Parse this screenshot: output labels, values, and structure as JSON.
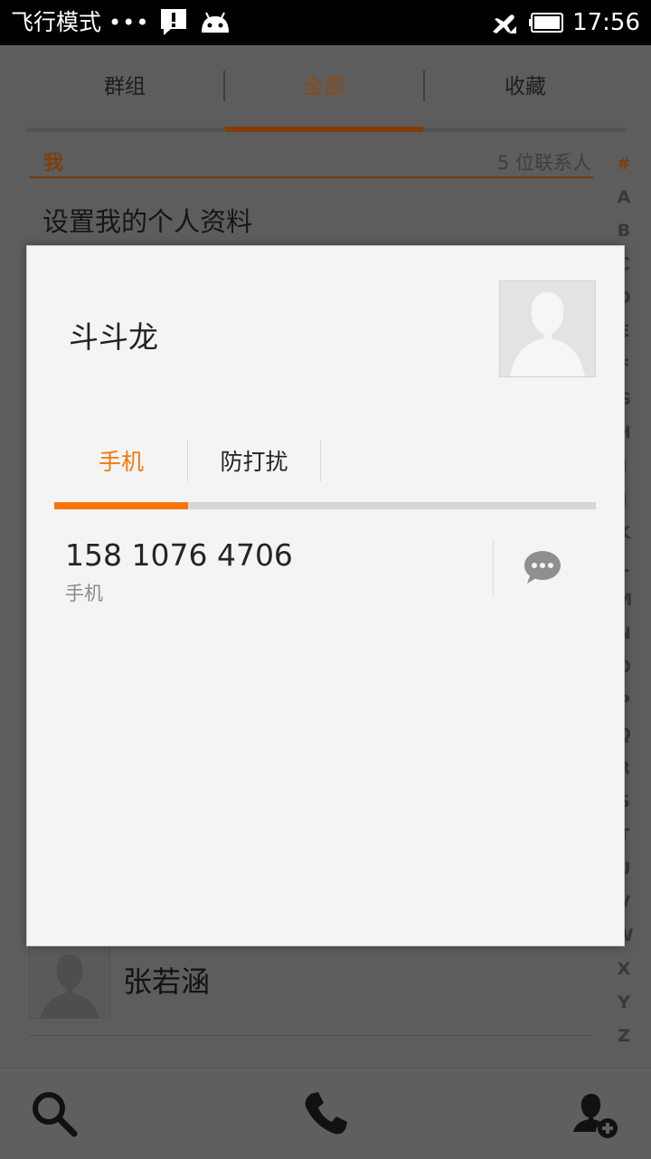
{
  "status_bar": {
    "mode_text": "飞行模式",
    "dots": "•••",
    "icons": [
      "alert-icon",
      "android-icon",
      "airplane-icon",
      "battery-icon"
    ],
    "time": "17:56"
  },
  "tabs": [
    {
      "label": "群组",
      "active": false
    },
    {
      "label": "全部",
      "active": true
    },
    {
      "label": "收藏",
      "active": false
    }
  ],
  "section": {
    "title": "我",
    "count": "5 位联系人"
  },
  "profile_setup": "设置我的个人资料",
  "index_letters": [
    "#",
    "A",
    "B",
    "C",
    "D",
    "E",
    "F",
    "G",
    "H",
    "I",
    "J",
    "K",
    "L",
    "M",
    "N",
    "O",
    "P",
    "Q",
    "R",
    "S",
    "T",
    "U",
    "V",
    "W",
    "X",
    "Y",
    "Z"
  ],
  "contact_visible": {
    "name": "张若涵"
  },
  "bottom_bar": {
    "icons": [
      "search-icon",
      "phone-icon",
      "add-contact-icon"
    ]
  },
  "dialog": {
    "name": "斗斗龙",
    "tabs": [
      {
        "label": "手机",
        "active": true
      },
      {
        "label": "防打扰",
        "active": false
      }
    ],
    "phone_number": "158 1076 4706",
    "phone_type": "手机",
    "action_icon": "message-icon"
  },
  "colors": {
    "accent": "#f7740f",
    "accent_dimmed": "#823d0a",
    "dim_background": "#5d5d5d",
    "dialog_background": "#f4f4f4"
  }
}
